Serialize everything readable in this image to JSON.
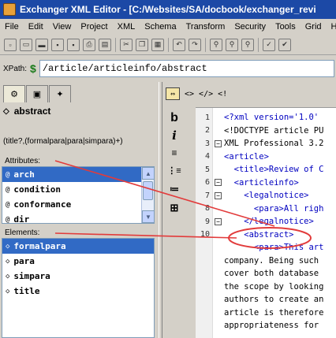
{
  "window": {
    "title": "Exchanger XML Editor - [C:/Websites/SA/docbook/exchanger_revi"
  },
  "menu": {
    "items": [
      "File",
      "Edit",
      "View",
      "Project",
      "XML",
      "Schema",
      "Transform",
      "Security",
      "Tools",
      "Grid",
      "Help"
    ]
  },
  "xpath": {
    "label": "XPath:",
    "value": "/article/articleinfo/abstract"
  },
  "left_panel": {
    "element_name": "abstract",
    "content_model": "(title?,(formalpara|para|simpara)+)",
    "attributes_label": "Attributes:",
    "attributes": [
      {
        "name": "arch",
        "selected": true
      },
      {
        "name": "condition",
        "selected": false
      },
      {
        "name": "conformance",
        "selected": false
      },
      {
        "name": "dir",
        "selected": false
      }
    ],
    "elements_label": "Elements:",
    "elements": [
      {
        "name": "formalpara",
        "selected": true
      },
      {
        "name": "para",
        "selected": false
      },
      {
        "name": "simpara",
        "selected": false
      },
      {
        "name": "title",
        "selected": false
      }
    ]
  },
  "editor": {
    "toolbar": [
      "<>",
      "</>",
      "<!"
    ],
    "line_numbers": [
      "1",
      "2",
      "3",
      "4",
      "5",
      "6",
      "7",
      "8",
      "9",
      "10",
      "",
      "",
      "",
      "",
      "",
      ""
    ],
    "lines": [
      {
        "text": "<?xml version='1.0'",
        "kind": "tag"
      },
      {
        "text": "<!DOCTYPE article PU",
        "kind": "txt"
      },
      {
        "text": "XML Professional 3.2",
        "kind": "txt"
      },
      {
        "text": "<article>",
        "kind": "tag"
      },
      {
        "text": "  <title>Review of C",
        "kind": "tag"
      },
      {
        "text": "  <articleinfo>",
        "kind": "tag"
      },
      {
        "text": "    <legalnotice>",
        "kind": "tag"
      },
      {
        "text": "      <para>All righ",
        "kind": "tag"
      },
      {
        "text": "    </legalnotice>",
        "kind": "tag"
      },
      {
        "text": "    <abstract>",
        "kind": "tag"
      },
      {
        "text": "      <para>This art",
        "kind": "tag"
      },
      {
        "text": "company. Being such",
        "kind": "txt"
      },
      {
        "text": "cover both database",
        "kind": "txt"
      },
      {
        "text": "the scope by looking",
        "kind": "txt"
      },
      {
        "text": "authors to create an",
        "kind": "txt"
      },
      {
        "text": "article is therefore",
        "kind": "txt"
      },
      {
        "text": "appropriateness for",
        "kind": "txt"
      }
    ]
  },
  "sidebar_icons": [
    "b",
    "i",
    "≡",
    "⋮≡",
    "≔",
    "⊞"
  ]
}
